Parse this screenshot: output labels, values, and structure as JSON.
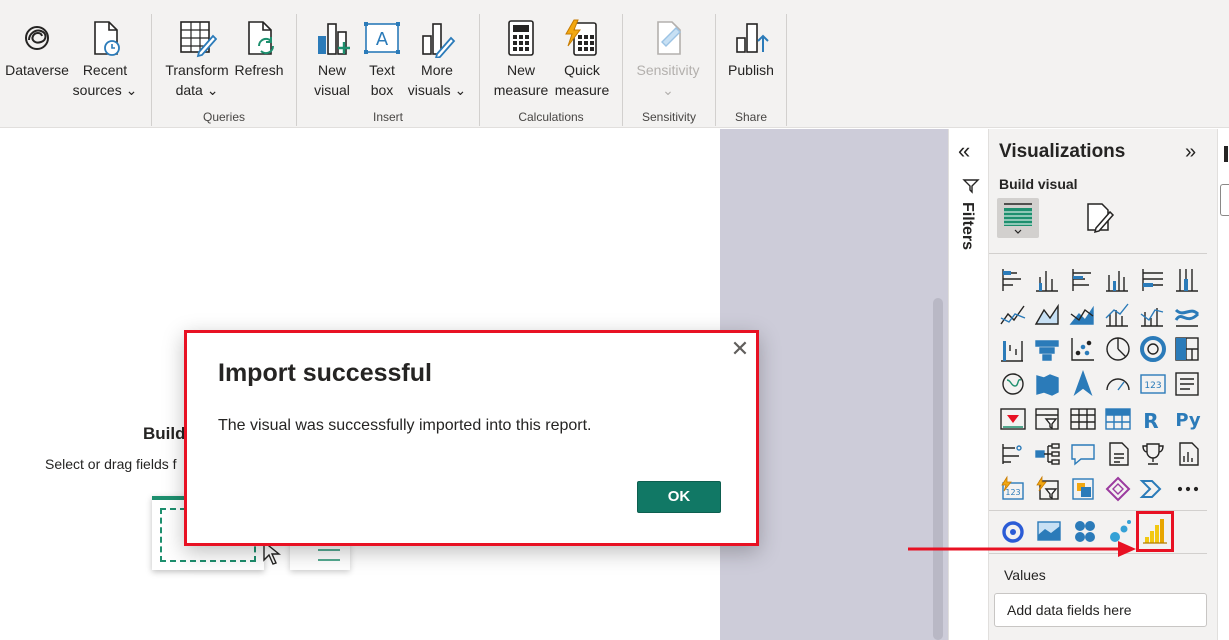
{
  "ribbon": {
    "buttons": [
      {
        "key": "dataverse",
        "label1": "Dataverse",
        "label2": ""
      },
      {
        "key": "recent_sources",
        "label1": "Recent",
        "label2": "sources ⌄"
      },
      {
        "key": "transform_data",
        "label1": "Transform",
        "label2": "data ⌄"
      },
      {
        "key": "refresh",
        "label1": "Refresh",
        "label2": ""
      },
      {
        "key": "new_visual",
        "label1": "New",
        "label2": "visual"
      },
      {
        "key": "text_box",
        "label1": "Text",
        "label2": "box"
      },
      {
        "key": "more_visuals",
        "label1": "More",
        "label2": "visuals ⌄"
      },
      {
        "key": "new_measure",
        "label1": "New",
        "label2": "measure"
      },
      {
        "key": "quick_measure",
        "label1": "Quick",
        "label2": "measure"
      },
      {
        "key": "sensitivity",
        "label1": "Sensitivity",
        "label2": "⌄"
      },
      {
        "key": "publish",
        "label1": "Publish",
        "label2": ""
      }
    ],
    "groups": {
      "queries": "Queries",
      "insert": "Insert",
      "calculations": "Calculations",
      "sensitivity": "Sensitivity",
      "share": "Share"
    }
  },
  "canvas": {
    "build_title": "Build",
    "build_subtitle": "Select or drag fields f"
  },
  "filters": {
    "label": "Filters",
    "collapse_glyph": "«"
  },
  "visualizations": {
    "title": "Visualizations",
    "collapse_glyph": "»",
    "build_visual_label": "Build visual",
    "values_label": "Values",
    "add_fields_placeholder": "Add data fields here"
  },
  "dialog": {
    "title": "Import successful",
    "message": "The visual was successfully imported into this report.",
    "ok_label": "OK",
    "close_glyph": "✕"
  },
  "colors": {
    "accent_green": "#117865",
    "highlight_red": "#e81123",
    "chart_blue": "#2b7bb9",
    "imported_visual_yellow": "#f2c811"
  }
}
